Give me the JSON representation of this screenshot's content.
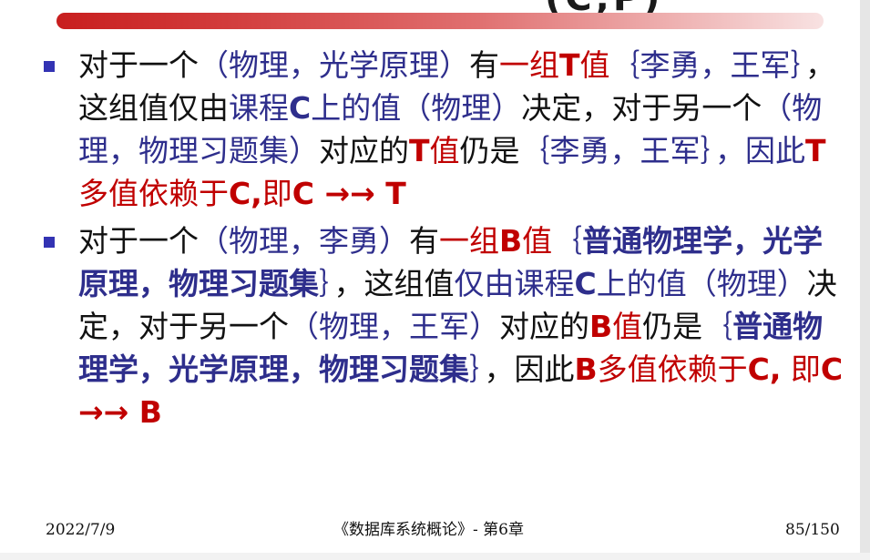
{
  "slide": {
    "title_fragment": "(C,P)",
    "bullets": [
      {
        "segments": [
          {
            "text": "对于一个",
            "color": "k",
            "bold": false
          },
          {
            "text": "（物理，光学原理）",
            "color": "b",
            "bold": false
          },
          {
            "text": "有",
            "color": "k",
            "bold": false
          },
          {
            "text": "一组",
            "color": "r",
            "bold": false
          },
          {
            "text": "T",
            "color": "r",
            "bold": true
          },
          {
            "text": "值",
            "color": "r",
            "bold": false
          },
          {
            "text": "｛李勇，王军｝",
            "color": "b",
            "bold": false
          },
          {
            "text": "，这组值仅由",
            "color": "k",
            "bold": false
          },
          {
            "text": "课程",
            "color": "b",
            "bold": false
          },
          {
            "text": "C",
            "color": "b",
            "bold": true
          },
          {
            "text": "上的值（物理）",
            "color": "b",
            "bold": false
          },
          {
            "text": "决定，对于另一个",
            "color": "k",
            "bold": false
          },
          {
            "text": "（物理，物理习题集）",
            "color": "b",
            "bold": false
          },
          {
            "text": "对应的",
            "color": "k",
            "bold": false
          },
          {
            "text": "T",
            "color": "r",
            "bold": true
          },
          {
            "text": "值",
            "color": "r",
            "bold": false
          },
          {
            "text": "仍是",
            "color": "k",
            "bold": false
          },
          {
            "text": "｛李勇，王军｝，因此",
            "color": "b",
            "bold": false
          },
          {
            "text": "T",
            "color": "r",
            "bold": true
          },
          {
            "text": "多值依赖于",
            "color": "r",
            "bold": false
          },
          {
            "text": "C,",
            "color": "r",
            "bold": true
          },
          {
            "text": "即",
            "color": "r",
            "bold": false
          },
          {
            "text": "C →→ T",
            "color": "r",
            "bold": true
          }
        ]
      },
      {
        "segments": [
          {
            "text": "对于一个",
            "color": "k",
            "bold": false
          },
          {
            "text": "（物理，李勇）",
            "color": "b",
            "bold": false
          },
          {
            "text": "有",
            "color": "k",
            "bold": false
          },
          {
            "text": "一组",
            "color": "r",
            "bold": false
          },
          {
            "text": "B",
            "color": "r",
            "bold": true
          },
          {
            "text": "值",
            "color": "r",
            "bold": false
          },
          {
            "text": "｛",
            "color": "b",
            "bold": false
          },
          {
            "text": "普通物理学，光学原理，物理习题集",
            "color": "b",
            "bold": true
          },
          {
            "text": "｝",
            "color": "b",
            "bold": false
          },
          {
            "text": "，这组值",
            "color": "k",
            "bold": false
          },
          {
            "text": "仅由课程",
            "color": "b",
            "bold": false
          },
          {
            "text": "C",
            "color": "b",
            "bold": true
          },
          {
            "text": "上的值（物理）",
            "color": "b",
            "bold": false
          },
          {
            "text": "决定，对于另一个",
            "color": "k",
            "bold": false
          },
          {
            "text": "（物理，王军）",
            "color": "b",
            "bold": false
          },
          {
            "text": "对应的",
            "color": "k",
            "bold": false
          },
          {
            "text": "B",
            "color": "r",
            "bold": true
          },
          {
            "text": "值",
            "color": "r",
            "bold": false
          },
          {
            "text": "仍是",
            "color": "k",
            "bold": false
          },
          {
            "text": "｛",
            "color": "b",
            "bold": false
          },
          {
            "text": "普通物理学，光学原理，物理习题集",
            "color": "b",
            "bold": true
          },
          {
            "text": "｝",
            "color": "b",
            "bold": false
          },
          {
            "text": "，因此",
            "color": "k",
            "bold": false
          },
          {
            "text": "B",
            "color": "r",
            "bold": true
          },
          {
            "text": "多值依赖于",
            "color": "r",
            "bold": false
          },
          {
            "text": "C,",
            "color": "r",
            "bold": true
          },
          {
            "text": " 即",
            "color": "r",
            "bold": false
          },
          {
            "text": "C →→ B",
            "color": "r",
            "bold": true
          }
        ]
      }
    ]
  },
  "footer": {
    "date": "2022/7/9",
    "center": "《数据库系统概论》- 第6章",
    "page": "85/150"
  },
  "colors": {
    "black": "#111111",
    "blue": "#2e2e8c",
    "red": "#c00000",
    "bullet": "#3333b3",
    "header_bar_start": "#c81e1e"
  }
}
